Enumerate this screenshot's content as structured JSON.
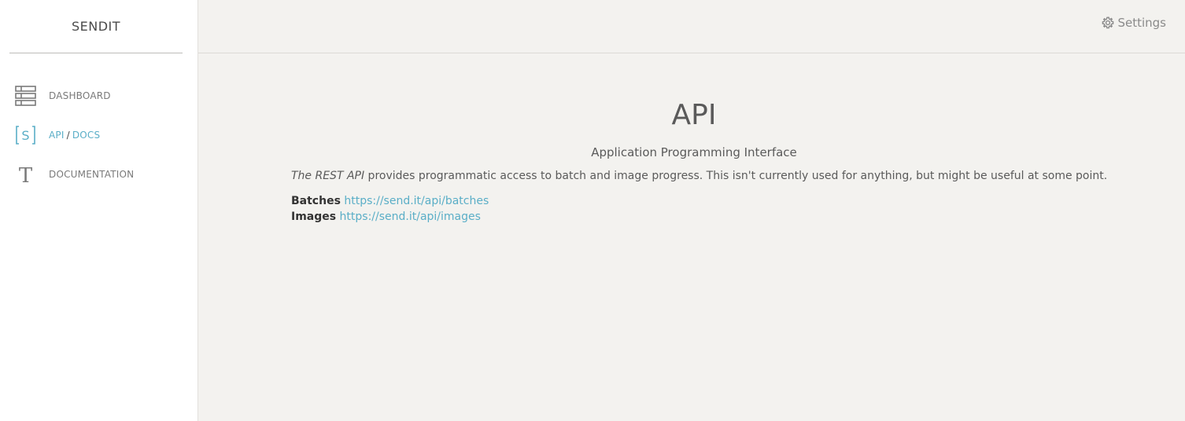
{
  "brand": "SENDIT",
  "nav": [
    {
      "icon": "list-icon",
      "label": "DASHBOARD"
    },
    {
      "icon": "bracket-s-icon",
      "label_part1": "API",
      "separator": "/",
      "label_part2": "DOCS",
      "active": true
    },
    {
      "icon": "text-t-icon",
      "label": "DOCUMENTATION"
    }
  ],
  "topbar": {
    "settings_label": "Settings",
    "settings_icon": "gear-icon"
  },
  "page": {
    "title": "API",
    "subtitle": "Application Programming Interface",
    "description_em": "The REST API",
    "description_rest": " provides programmatic access to batch and image progress. This isn't currently used for anything, but might be useful at some point.",
    "endpoints": [
      {
        "name": "Batches",
        "url": "https://send.it/api/batches"
      },
      {
        "name": "Images",
        "url": "https://send.it/api/images"
      }
    ]
  },
  "colors": {
    "accent": "#5aaec7",
    "background": "#f3f2ef",
    "sidebar": "#ffffff"
  }
}
